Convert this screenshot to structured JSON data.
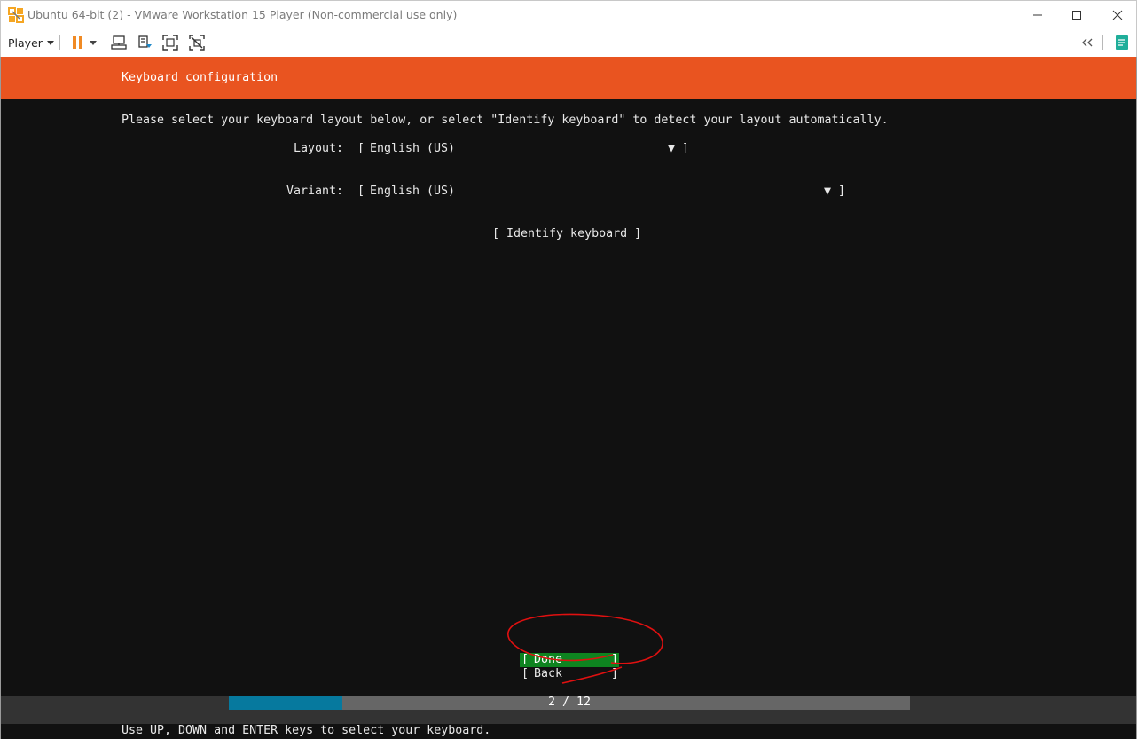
{
  "window": {
    "title": "Ubuntu 64-bit (2) - VMware Workstation 15 Player (Non-commercial use only)"
  },
  "toolbar": {
    "player_menu_label": "Player",
    "icons": [
      "pause-icon",
      "dropdown-arrow-icon",
      "send-ctrl-alt-del-icon",
      "removable-devices-icon",
      "full-screen-icon",
      "unity-icon",
      "collapse-icon",
      "message-log-icon"
    ]
  },
  "installer": {
    "header_title": "Keyboard configuration",
    "instruction": "Please select your keyboard layout below, or select \"Identify keyboard\" to detect your layout automatically.",
    "layout": {
      "label": "Layout:",
      "value": "English (US)"
    },
    "variant": {
      "label": "Variant:",
      "value": "English (US)"
    },
    "bracket_open": "[",
    "bracket_close": "]",
    "dropdown_arrow": "▼",
    "identify_button": "[ Identify keyboard ]",
    "done_button": "Done",
    "back_button": "Back",
    "progress": {
      "text": "2 / 12",
      "current": 2,
      "total": 12
    },
    "help_text": "Use UP, DOWN and ENTER keys to select your keyboard."
  },
  "colors": {
    "header": "#e95420",
    "screen_background": "#111111",
    "done_highlight": "#0e8420",
    "progress_fill": "#06799e",
    "progress_track": "#666666",
    "footer": "#333333",
    "annotation": "#e01010"
  }
}
